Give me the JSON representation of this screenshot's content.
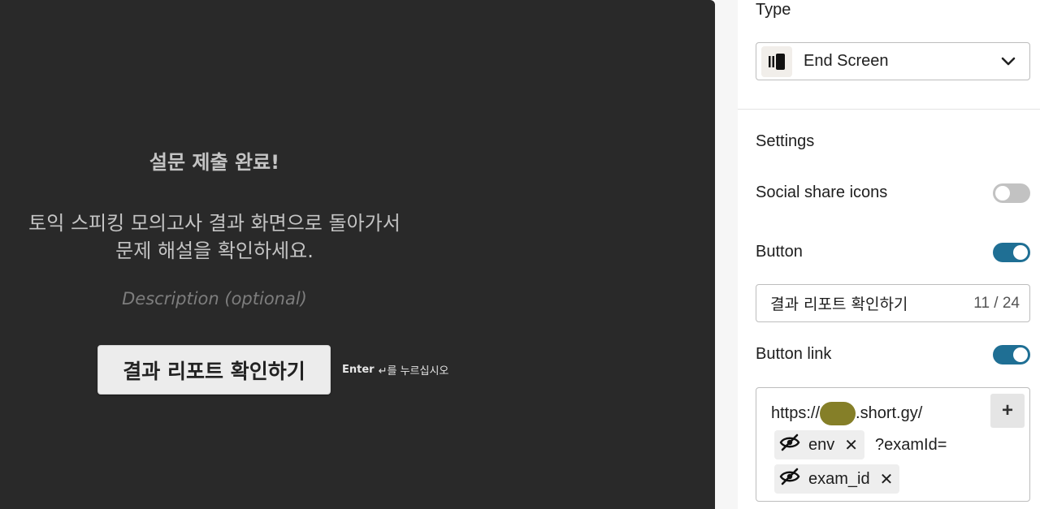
{
  "preview": {
    "title": "설문 제출 완료!",
    "message_line1": "토익 스피킹 모의고사 결과 화면으로 돌아가서",
    "message_line2": "문제 해설을 확인하세요.",
    "description_placeholder": "Description (optional)",
    "button_label": "결과 리포트 확인하기",
    "hint_key": "Enter",
    "hint_arrow": "↵",
    "hint_text": "를 누르십시오"
  },
  "panel": {
    "type_label": "Type",
    "type_value": "End Screen",
    "type_icon": "end-screen-icon",
    "settings_label": "Settings",
    "social_share_label": "Social share icons",
    "social_share_enabled": false,
    "button_label": "Button",
    "button_enabled": true,
    "button_text_value": "결과 리포트 확인하기",
    "button_text_counter": "11 / 24",
    "button_link_label": "Button link",
    "button_link_enabled": true,
    "link": {
      "prefix": "https://",
      "suffix": ".short.gy/",
      "add_label": "+",
      "chip1": "env",
      "between": "?examId=",
      "chip2": "exam_id",
      "remove_label": "✕"
    }
  },
  "colors": {
    "preview_bg": "#292929",
    "toggle_on": "#1f6f94",
    "toggle_off": "#c2c2c2",
    "redaction": "#857f28"
  }
}
